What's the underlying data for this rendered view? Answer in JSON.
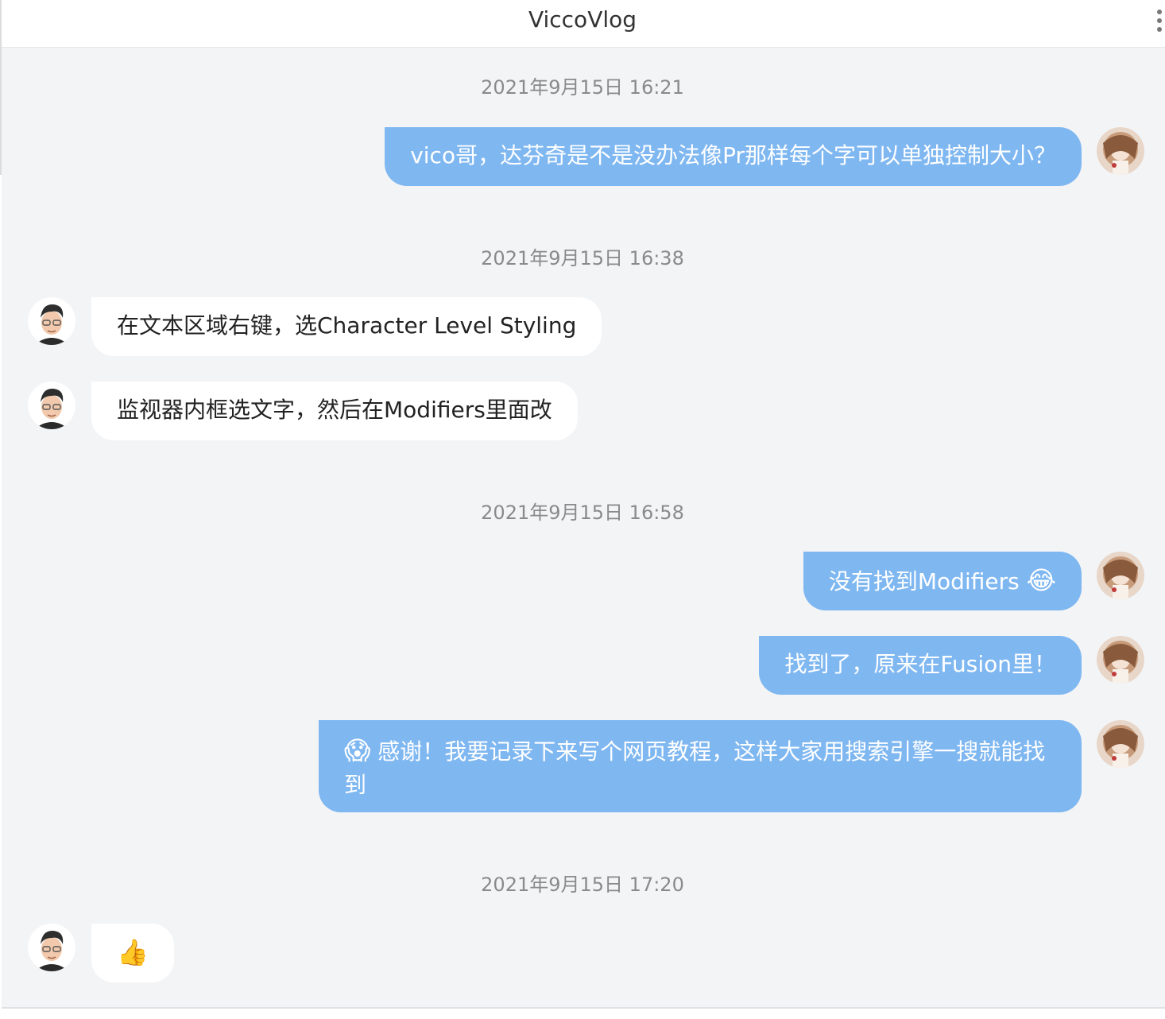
{
  "header": {
    "title": "ViccoVlog",
    "more_icon": "more-vertical-icon"
  },
  "colors": {
    "outgoing_bubble": "#7fb7f1",
    "incoming_bubble": "#ffffff",
    "chat_background": "#f3f4f6"
  },
  "messages": [
    {
      "timestamp": "2021年9月15日 16:21"
    },
    {
      "text": "vico哥，达芬奇是不是没办法像Pr那样每个字可以单独控制大小？"
    },
    {
      "timestamp": "2021年9月15日 16:38"
    },
    {
      "text": "在文本区域右键，选Character Level Styling"
    },
    {
      "text": "监视器内框选文字，然后在Modifiers里面改"
    },
    {
      "timestamp": "2021年9月15日 16:58"
    },
    {
      "text": "没有找到Modifiers",
      "emoji": "😂"
    },
    {
      "text": "找到了，原来在Fusion里！"
    },
    {
      "emoji": "😱",
      "text": "感谢！我要记录下来写个网页教程，这样大家用搜索引擎一搜就能找到"
    },
    {
      "timestamp": "2021年9月15日 17:20"
    },
    {
      "emoji": "👍"
    }
  ]
}
